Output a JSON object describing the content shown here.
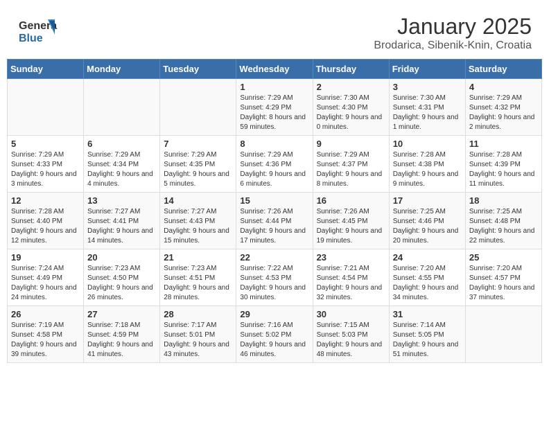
{
  "header": {
    "title": "January 2025",
    "subtitle": "Brodarica, Sibenik-Knin, Croatia",
    "logo_general": "General",
    "logo_blue": "Blue"
  },
  "weekdays": [
    "Sunday",
    "Monday",
    "Tuesday",
    "Wednesday",
    "Thursday",
    "Friday",
    "Saturday"
  ],
  "weeks": [
    [
      {
        "day": "",
        "info": ""
      },
      {
        "day": "",
        "info": ""
      },
      {
        "day": "",
        "info": ""
      },
      {
        "day": "1",
        "info": "Sunrise: 7:29 AM\nSunset: 4:29 PM\nDaylight: 8 hours and 59 minutes."
      },
      {
        "day": "2",
        "info": "Sunrise: 7:30 AM\nSunset: 4:30 PM\nDaylight: 9 hours and 0 minutes."
      },
      {
        "day": "3",
        "info": "Sunrise: 7:30 AM\nSunset: 4:31 PM\nDaylight: 9 hours and 1 minute."
      },
      {
        "day": "4",
        "info": "Sunrise: 7:29 AM\nSunset: 4:32 PM\nDaylight: 9 hours and 2 minutes."
      }
    ],
    [
      {
        "day": "5",
        "info": "Sunrise: 7:29 AM\nSunset: 4:33 PM\nDaylight: 9 hours and 3 minutes."
      },
      {
        "day": "6",
        "info": "Sunrise: 7:29 AM\nSunset: 4:34 PM\nDaylight: 9 hours and 4 minutes."
      },
      {
        "day": "7",
        "info": "Sunrise: 7:29 AM\nSunset: 4:35 PM\nDaylight: 9 hours and 5 minutes."
      },
      {
        "day": "8",
        "info": "Sunrise: 7:29 AM\nSunset: 4:36 PM\nDaylight: 9 hours and 6 minutes."
      },
      {
        "day": "9",
        "info": "Sunrise: 7:29 AM\nSunset: 4:37 PM\nDaylight: 9 hours and 8 minutes."
      },
      {
        "day": "10",
        "info": "Sunrise: 7:28 AM\nSunset: 4:38 PM\nDaylight: 9 hours and 9 minutes."
      },
      {
        "day": "11",
        "info": "Sunrise: 7:28 AM\nSunset: 4:39 PM\nDaylight: 9 hours and 11 minutes."
      }
    ],
    [
      {
        "day": "12",
        "info": "Sunrise: 7:28 AM\nSunset: 4:40 PM\nDaylight: 9 hours and 12 minutes."
      },
      {
        "day": "13",
        "info": "Sunrise: 7:27 AM\nSunset: 4:41 PM\nDaylight: 9 hours and 14 minutes."
      },
      {
        "day": "14",
        "info": "Sunrise: 7:27 AM\nSunset: 4:43 PM\nDaylight: 9 hours and 15 minutes."
      },
      {
        "day": "15",
        "info": "Sunrise: 7:26 AM\nSunset: 4:44 PM\nDaylight: 9 hours and 17 minutes."
      },
      {
        "day": "16",
        "info": "Sunrise: 7:26 AM\nSunset: 4:45 PM\nDaylight: 9 hours and 19 minutes."
      },
      {
        "day": "17",
        "info": "Sunrise: 7:25 AM\nSunset: 4:46 PM\nDaylight: 9 hours and 20 minutes."
      },
      {
        "day": "18",
        "info": "Sunrise: 7:25 AM\nSunset: 4:48 PM\nDaylight: 9 hours and 22 minutes."
      }
    ],
    [
      {
        "day": "19",
        "info": "Sunrise: 7:24 AM\nSunset: 4:49 PM\nDaylight: 9 hours and 24 minutes."
      },
      {
        "day": "20",
        "info": "Sunrise: 7:23 AM\nSunset: 4:50 PM\nDaylight: 9 hours and 26 minutes."
      },
      {
        "day": "21",
        "info": "Sunrise: 7:23 AM\nSunset: 4:51 PM\nDaylight: 9 hours and 28 minutes."
      },
      {
        "day": "22",
        "info": "Sunrise: 7:22 AM\nSunset: 4:53 PM\nDaylight: 9 hours and 30 minutes."
      },
      {
        "day": "23",
        "info": "Sunrise: 7:21 AM\nSunset: 4:54 PM\nDaylight: 9 hours and 32 minutes."
      },
      {
        "day": "24",
        "info": "Sunrise: 7:20 AM\nSunset: 4:55 PM\nDaylight: 9 hours and 34 minutes."
      },
      {
        "day": "25",
        "info": "Sunrise: 7:20 AM\nSunset: 4:57 PM\nDaylight: 9 hours and 37 minutes."
      }
    ],
    [
      {
        "day": "26",
        "info": "Sunrise: 7:19 AM\nSunset: 4:58 PM\nDaylight: 9 hours and 39 minutes."
      },
      {
        "day": "27",
        "info": "Sunrise: 7:18 AM\nSunset: 4:59 PM\nDaylight: 9 hours and 41 minutes."
      },
      {
        "day": "28",
        "info": "Sunrise: 7:17 AM\nSunset: 5:01 PM\nDaylight: 9 hours and 43 minutes."
      },
      {
        "day": "29",
        "info": "Sunrise: 7:16 AM\nSunset: 5:02 PM\nDaylight: 9 hours and 46 minutes."
      },
      {
        "day": "30",
        "info": "Sunrise: 7:15 AM\nSunset: 5:03 PM\nDaylight: 9 hours and 48 minutes."
      },
      {
        "day": "31",
        "info": "Sunrise: 7:14 AM\nSunset: 5:05 PM\nDaylight: 9 hours and 51 minutes."
      },
      {
        "day": "",
        "info": ""
      }
    ]
  ]
}
